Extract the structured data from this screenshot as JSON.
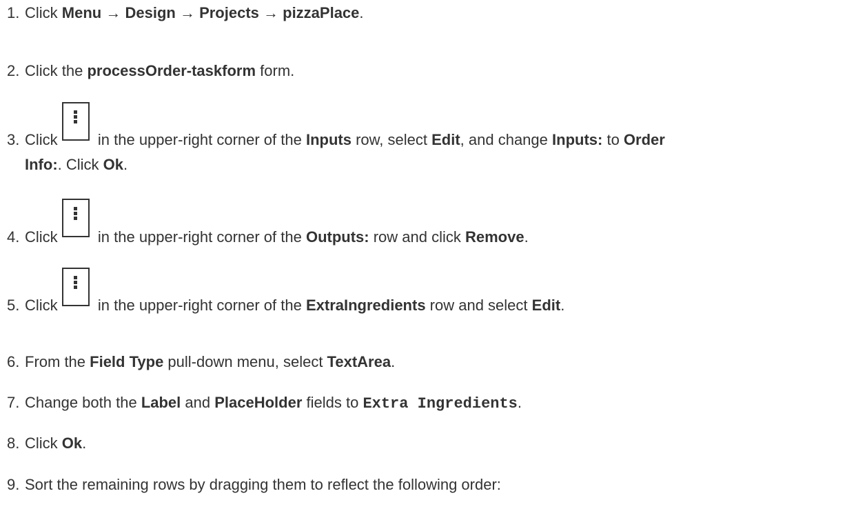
{
  "steps": [
    {
      "num": "1.",
      "parts": [
        {
          "t": "Click "
        },
        {
          "t": "Menu",
          "b": true
        },
        {
          "t": " → "
        },
        {
          "t": "Design",
          "b": true
        },
        {
          "t": " → "
        },
        {
          "t": "Projects",
          "b": true
        },
        {
          "t": " → "
        },
        {
          "t": "pizzaPlace",
          "b": true
        },
        {
          "t": "."
        }
      ]
    },
    {
      "num": "2.",
      "parts": [
        {
          "t": "Click the "
        },
        {
          "t": "processOrder-taskform",
          "b": true
        },
        {
          "t": " form."
        }
      ]
    },
    {
      "num": "3.",
      "icon": "kebab-menu-icon",
      "line1": [
        {
          "t": "Click "
        },
        {
          "icon": true
        },
        {
          "t": " in the upper-right corner of the "
        },
        {
          "t": "Inputs",
          "b": true
        },
        {
          "t": " row, select "
        },
        {
          "t": "Edit",
          "b": true
        },
        {
          "t": ", and change "
        },
        {
          "t": "Inputs:",
          "b": true
        },
        {
          "t": " to "
        },
        {
          "t": "Order",
          "b": true
        }
      ],
      "line2": [
        {
          "t": "Info:",
          "b": true
        },
        {
          "t": ". Click "
        },
        {
          "t": "Ok",
          "b": true
        },
        {
          "t": "."
        }
      ]
    },
    {
      "num": "4.",
      "icon": "kebab-menu-icon",
      "parts": [
        {
          "t": "Click "
        },
        {
          "icon": true
        },
        {
          "t": " in the upper-right corner of the "
        },
        {
          "t": "Outputs:",
          "b": true
        },
        {
          "t": " row and click "
        },
        {
          "t": "Remove",
          "b": true
        },
        {
          "t": "."
        }
      ]
    },
    {
      "num": "5.",
      "icon": "kebab-menu-icon",
      "parts": [
        {
          "t": "Click "
        },
        {
          "icon": true
        },
        {
          "t": " in the upper-right corner of the "
        },
        {
          "t": "ExtraIngredients",
          "b": true
        },
        {
          "t": " row and select "
        },
        {
          "t": "Edit",
          "b": true
        },
        {
          "t": "."
        }
      ]
    },
    {
      "num": "6.",
      "parts": [
        {
          "t": "From the "
        },
        {
          "t": "Field Type",
          "b": true
        },
        {
          "t": " pull-down menu, select "
        },
        {
          "t": "TextArea",
          "b": true
        },
        {
          "t": "."
        }
      ]
    },
    {
      "num": "7.",
      "parts": [
        {
          "t": "Change both the "
        },
        {
          "t": "Label",
          "b": true
        },
        {
          "t": " and "
        },
        {
          "t": "PlaceHolder",
          "b": true
        },
        {
          "t": " fields to "
        },
        {
          "t": "Extra Ingredients",
          "code": true
        },
        {
          "t": "."
        }
      ]
    },
    {
      "num": "8.",
      "parts": [
        {
          "t": "Click "
        },
        {
          "t": "Ok",
          "b": true
        },
        {
          "t": "."
        }
      ]
    },
    {
      "num": "9.",
      "parts": [
        {
          "t": "Sort the remaining rows by dragging them to reflect the following order:"
        }
      ]
    }
  ]
}
